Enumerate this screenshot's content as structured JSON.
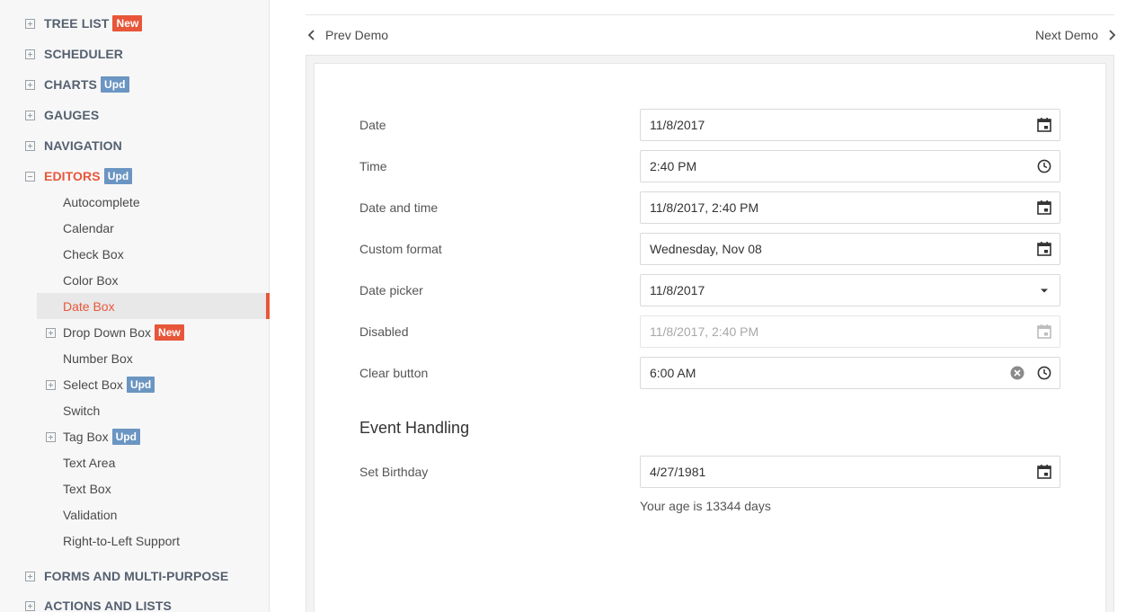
{
  "nav": {
    "categories": [
      {
        "label": "TREE LIST",
        "badge": "New"
      },
      {
        "label": "SCHEDULER",
        "badge": ""
      },
      {
        "label": "CHARTS",
        "badge": "Upd"
      },
      {
        "label": "GAUGES",
        "badge": ""
      },
      {
        "label": "NAVIGATION",
        "badge": ""
      },
      {
        "label": "EDITORS",
        "badge": "Upd"
      },
      {
        "label": "FORMS AND MULTI-PURPOSE",
        "badge": ""
      },
      {
        "label": "ACTIONS AND LISTS",
        "badge": ""
      }
    ],
    "editors_items": [
      {
        "label": "Autocomplete",
        "badge": ""
      },
      {
        "label": "Calendar",
        "badge": ""
      },
      {
        "label": "Check Box",
        "badge": ""
      },
      {
        "label": "Color Box",
        "badge": ""
      },
      {
        "label": "Date Box",
        "badge": ""
      },
      {
        "label": "Drop Down Box",
        "badge": "New"
      },
      {
        "label": "Number Box",
        "badge": ""
      },
      {
        "label": "Select Box",
        "badge": "Upd"
      },
      {
        "label": "Switch",
        "badge": ""
      },
      {
        "label": "Tag Box",
        "badge": "Upd"
      },
      {
        "label": "Text Area",
        "badge": ""
      },
      {
        "label": "Text Box",
        "badge": ""
      },
      {
        "label": "Validation",
        "badge": ""
      },
      {
        "label": "Right-to-Left Support",
        "badge": ""
      }
    ],
    "active_item": "Date Box"
  },
  "demo_nav": {
    "prev": "Prev Demo",
    "next": "Next Demo"
  },
  "form": {
    "rows": [
      {
        "label": "Date",
        "value": "11/8/2017",
        "icon": "calendar-icon"
      },
      {
        "label": "Time",
        "value": "2:40 PM",
        "icon": "clock-icon"
      },
      {
        "label": "Date and time",
        "value": "11/8/2017, 2:40 PM",
        "icon": "calendar-icon"
      },
      {
        "label": "Custom format",
        "value": "Wednesday, Nov 08",
        "icon": "calendar-icon"
      },
      {
        "label": "Date picker",
        "value": "11/8/2017",
        "icon": "dropdown-arrow-icon"
      },
      {
        "label": "Disabled",
        "value": "11/8/2017, 2:40 PM",
        "icon": "calendar-icon"
      },
      {
        "label": "Clear button",
        "value": "6:00 AM",
        "icon": "clock-icon"
      }
    ],
    "event_title": "Event Handling",
    "birthday": {
      "label": "Set Birthday",
      "value": "4/27/1981",
      "icon": "calendar-icon"
    },
    "age_text": "Your age is 13344 days"
  },
  "colors": {
    "accent": "#e8563a",
    "badge_new": "#e8563a",
    "badge_upd": "#6b95c2",
    "category_text": "#556070"
  }
}
